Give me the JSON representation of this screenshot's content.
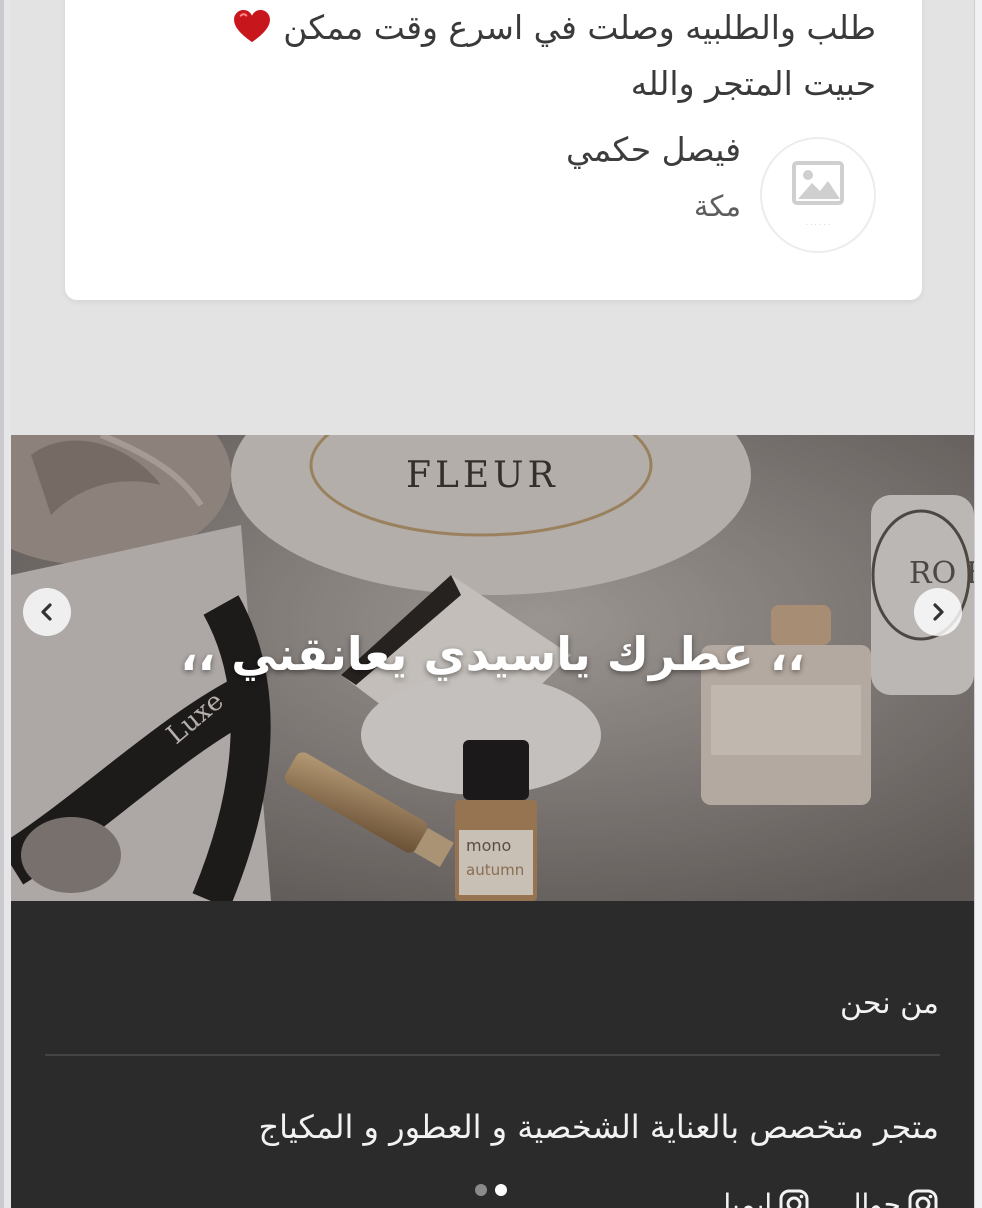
{
  "review": {
    "text_part1": "طلب والطلبيه وصلت في اسرع وقت ممكن",
    "text_part2": "حبيت المتجر والله",
    "author_name": "فيصل حكمي",
    "author_city": "مكة",
    "heart_icon": "heart-icon",
    "heart_color": "#c8161d"
  },
  "banner": {
    "title": "،، عطرك ياسيدي يعانقني ،،",
    "prev_icon": "chevron-left-icon",
    "next_icon": "chevron-right-icon",
    "product_text": {
      "fleur": "FLEUR",
      "luxe": "Luxe",
      "bottle_brand": "mono",
      "bottle_variant": "autumn",
      "candle": "RO ES"
    }
  },
  "footer": {
    "heading": "من نحن",
    "about": "متجر متخصص بالعناية الشخصية و العطور و المكياج",
    "social": [
      {
        "icon": "instagram-icon",
        "label": "جوال"
      },
      {
        "icon": "instagram-icon",
        "label": "ايميل"
      }
    ],
    "dots": {
      "count": 2,
      "active_index": 1
    },
    "background": "#2b2b2b"
  }
}
